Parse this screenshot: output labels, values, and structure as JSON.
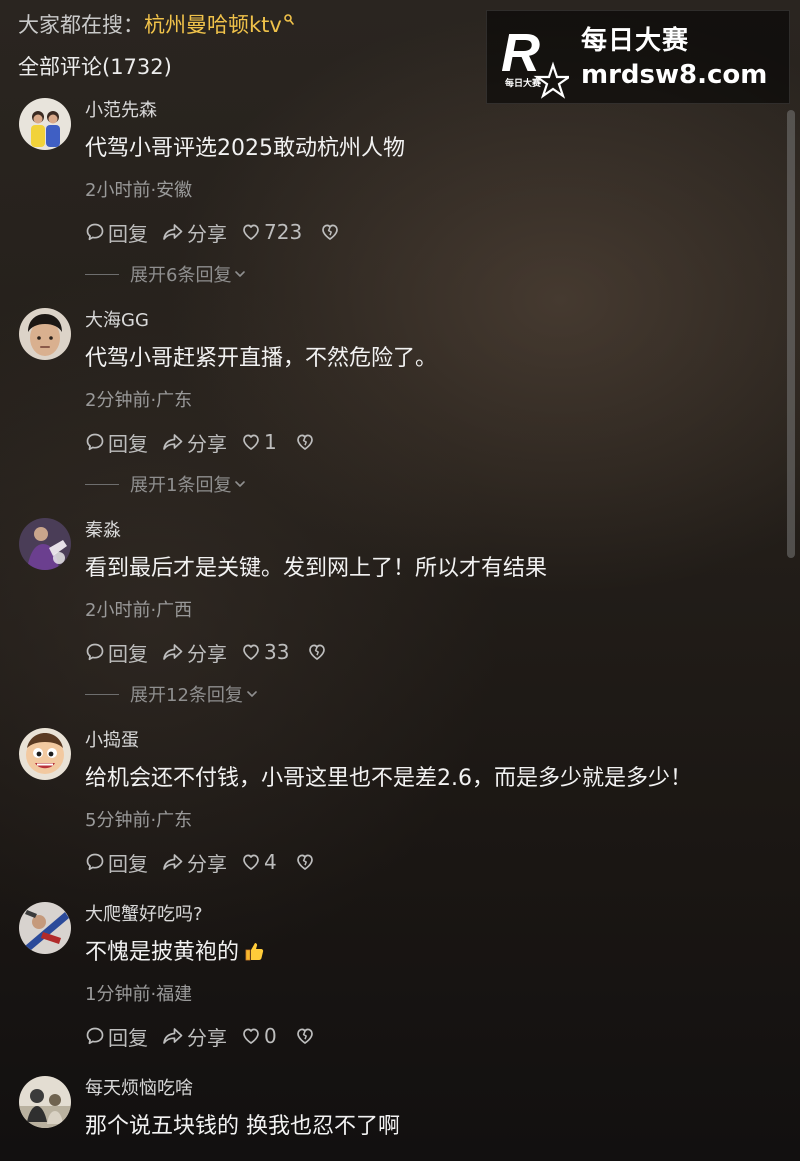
{
  "header": {
    "search_prefix": "大家都在搜：",
    "search_term": "杭州曼哈顿ktv",
    "comments_title": "全部评论(1732)"
  },
  "watermark": {
    "name": "每日大赛",
    "url": "mrdsw8.com"
  },
  "labels": {
    "reply": "回复",
    "share": "分享"
  },
  "comments": [
    {
      "username": "小范先森",
      "text": "代驾小哥评选2025敢动杭州人物",
      "meta": "2小时前·安徽",
      "likes": "723",
      "expand": "展开6条回复"
    },
    {
      "username": "大海GG",
      "text": "代驾小哥赶紧开直播，不然危险了。",
      "meta": "2分钟前·广东",
      "likes": "1",
      "expand": "展开1条回复"
    },
    {
      "username": "秦淼",
      "text": "看到最后才是关键。发到网上了！所以才有结果",
      "meta": "2小时前·广西",
      "likes": "33",
      "expand": "展开12条回复"
    },
    {
      "username": "小捣蛋",
      "text": "给机会还不付钱，小哥这里也不是差2.6，而是多少就是多少！",
      "meta": "5分钟前·广东",
      "likes": "4"
    },
    {
      "username": "大爬蟹好吃吗?",
      "text": "不愧是披黄袍的",
      "meta": "1分钟前·福建",
      "likes": "0"
    },
    {
      "username": "每天烦恼吃啥",
      "text": "那个说五块钱的 换我也忍不了啊"
    }
  ],
  "icons": {
    "search": "search-icon",
    "reply": "speech-bubble-icon",
    "share": "share-arrow-icon",
    "like": "heart-icon",
    "dislike": "broken-heart-icon",
    "expand": "chevron-down-icon",
    "emoji": "thumbs-up-emoji-icon"
  },
  "colors": {
    "search_link": "#f0c24a",
    "text": "#f2f2f2",
    "meta": "#9a9a9a",
    "background": "#1b1714"
  }
}
